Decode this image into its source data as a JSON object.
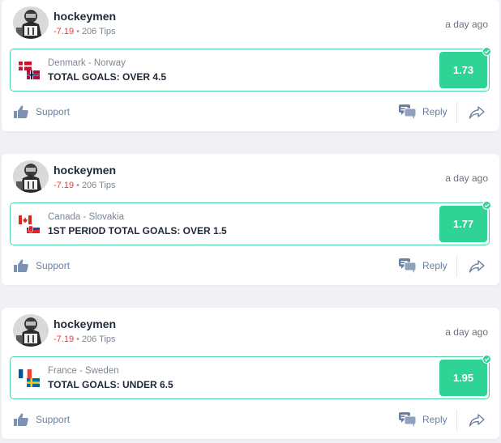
{
  "colors": {
    "accent": "#2fd396",
    "border": "#4cd4a0",
    "negative": "#e53e3e",
    "action": "#6b7fa0"
  },
  "posts": [
    {
      "author": "hockeymen",
      "profit": "-7.19",
      "separator": "•",
      "tips": "206 Tips",
      "time": "a day ago",
      "match": "Denmark - Norway",
      "market": "TOTAL GOALS: OVER 4.5",
      "odds": "1.73",
      "support_label": "Support",
      "reply_label": "Reply",
      "flags": [
        "flag-denmark-icon",
        "flag-norway-icon"
      ]
    },
    {
      "author": "hockeymen",
      "profit": "-7.19",
      "separator": "•",
      "tips": "206 Tips",
      "time": "a day ago",
      "match": "Canada - Slovakia",
      "market": "1ST PERIOD TOTAL GOALS: OVER 1.5",
      "odds": "1.77",
      "support_label": "Support",
      "reply_label": "Reply",
      "flags": [
        "flag-canada-icon",
        "flag-slovakia-icon"
      ]
    },
    {
      "author": "hockeymen",
      "profit": "-7.19",
      "separator": "•",
      "tips": "206 Tips",
      "time": "a day ago",
      "match": "France - Sweden",
      "market": "TOTAL GOALS: UNDER 6.5",
      "odds": "1.95",
      "support_label": "Support",
      "reply_label": "Reply",
      "flags": [
        "flag-france-icon",
        "flag-sweden-icon"
      ]
    }
  ]
}
